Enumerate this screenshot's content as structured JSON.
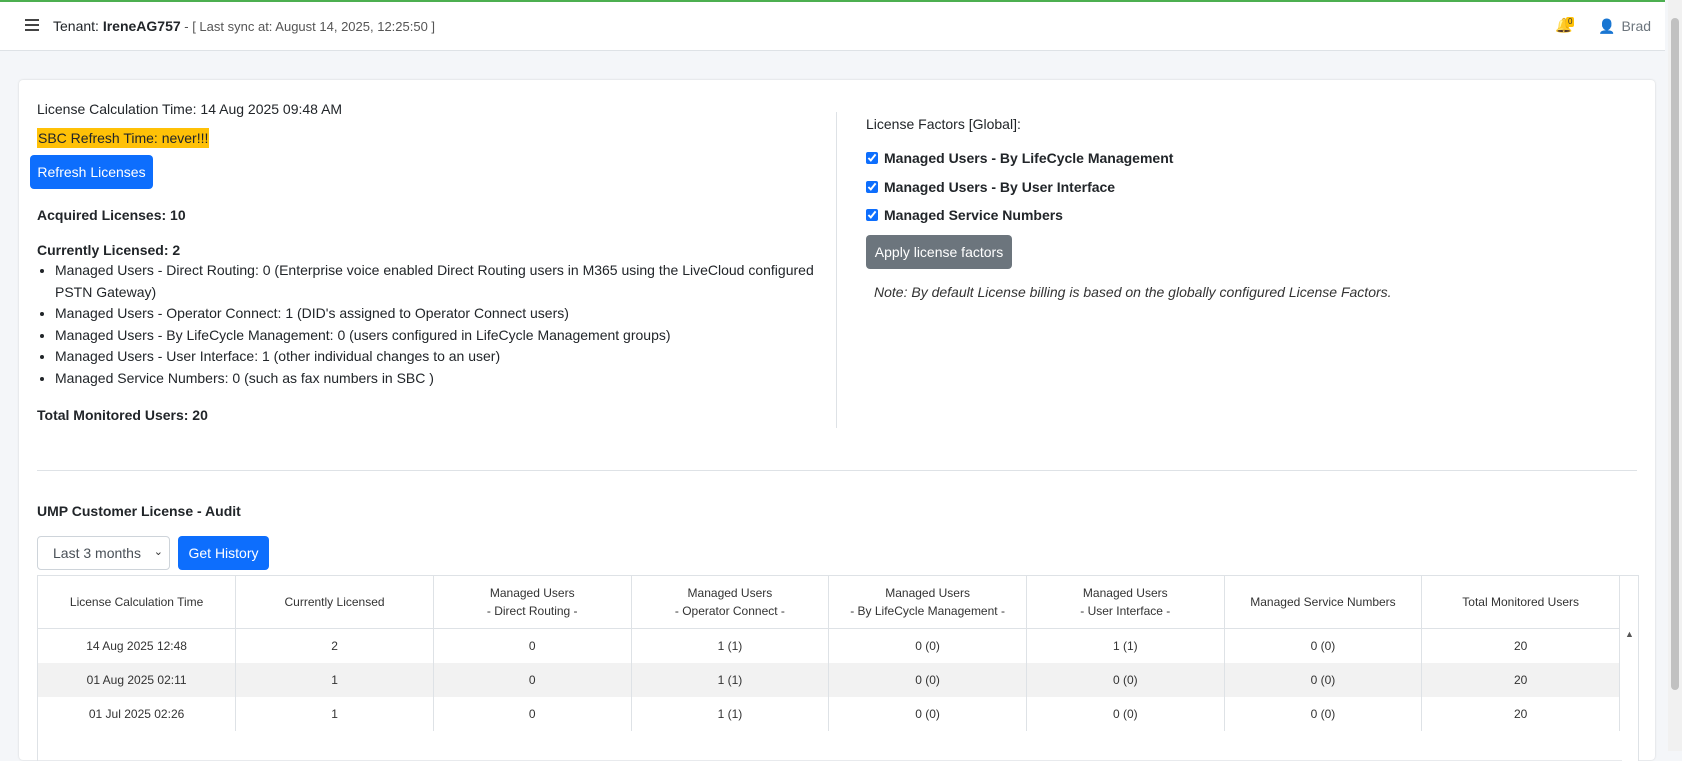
{
  "header": {
    "tenant_label": "Tenant:",
    "tenant_name": "IreneAG757",
    "sync_text": " - [ Last sync at: August 14, 2025, 12:25:50 ]",
    "notification_count": "0",
    "user_name": "Brad"
  },
  "license": {
    "calc_time": "License Calculation Time: 14 Aug 2025 09:48 AM",
    "sbc_refresh": "SBC Refresh Time: never!!!",
    "refresh_button": "Refresh Licenses",
    "acquired": "Acquired Licenses: 10",
    "currently_licensed": "Currently Licensed: 2",
    "items": [
      "Managed Users - Direct Routing: 0 (Enterprise voice enabled Direct Routing users in M365 using the LiveCloud configured PSTN Gateway)",
      "Managed Users - Operator Connect: 1 (DID's assigned to Operator Connect users)",
      "Managed Users - By LifeCycle Management: 0 (users configured in LifeCycle Management groups)",
      "Managed Users - User Interface: 1 (other individual changes to an user)",
      "Managed Service Numbers: 0 (such as fax numbers in SBC )"
    ],
    "total_monitored": "Total Monitored Users: 20"
  },
  "factors": {
    "title": "License Factors [Global]:",
    "items": [
      {
        "label": "Managed Users - By LifeCycle Management",
        "checked": true
      },
      {
        "label": "Managed Users - By User Interface",
        "checked": true
      },
      {
        "label": "Managed Service Numbers",
        "checked": true
      }
    ],
    "apply_button": "Apply license factors",
    "note": "Note: By default License billing is based on the globally configured License Factors."
  },
  "audit": {
    "title": "UMP Customer License - Audit",
    "period_selected": "Last 3 months",
    "history_button": "Get History",
    "columns": [
      "License Calculation Time",
      "Currently Licensed",
      "Managed Users\n- Direct Routing -",
      "Managed Users\n- Operator Connect -",
      "Managed Users\n- By LifeCycle Management -",
      "Managed Users\n- User Interface -",
      "Managed Service Numbers",
      "Total Monitored Users"
    ],
    "rows": [
      [
        "14 Aug 2025 12:48",
        "2",
        "0",
        "1 (1)",
        "0 (0)",
        "1 (1)",
        "0 (0)",
        "20"
      ],
      [
        "01 Aug 2025 02:11",
        "1",
        "0",
        "1 (1)",
        "0 (0)",
        "0 (0)",
        "0 (0)",
        "20"
      ],
      [
        "01 Jul 2025 02:26",
        "1",
        "0",
        "1 (1)",
        "0 (0)",
        "0 (0)",
        "0 (0)",
        "20"
      ]
    ]
  },
  "colors": {
    "primary": "#0d6efd",
    "secondary": "#6c757d",
    "highlight": "#ffc107",
    "top_border": "#4caf50"
  },
  "icons": [
    "hamburger-icon",
    "bell-icon",
    "user-icon",
    "chevron-down-icon"
  ]
}
